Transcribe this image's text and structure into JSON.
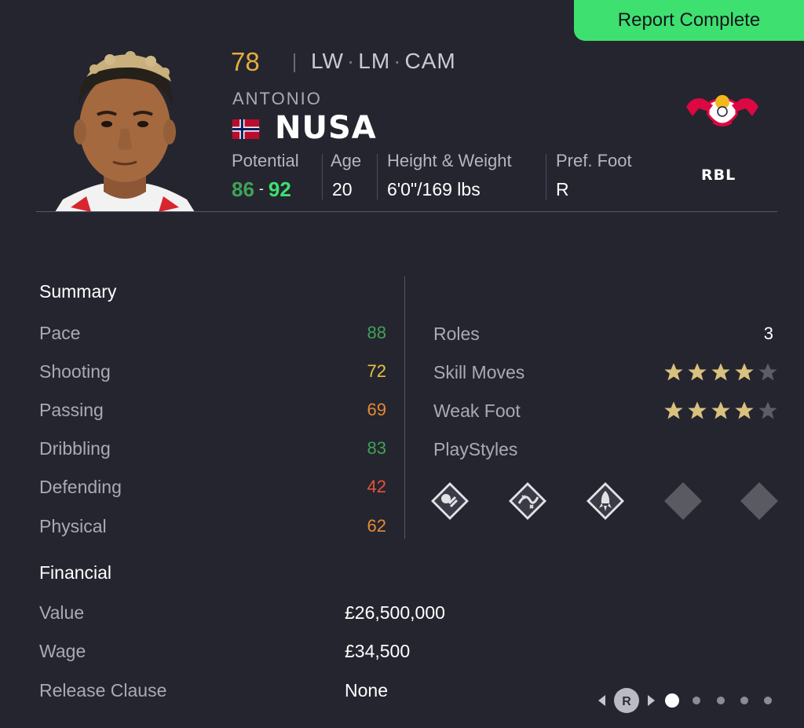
{
  "status_badge": "Report Complete",
  "player": {
    "overall": "78",
    "positions": [
      "LW",
      "LM",
      "CAM"
    ],
    "first_name": "ANTONIO",
    "last_name": "NUSA",
    "nationality_flag": "norway-flag-icon"
  },
  "attributes": {
    "potential": {
      "label": "Potential",
      "low": "86",
      "separator": "-",
      "high": "92"
    },
    "age": {
      "label": "Age",
      "value": "20"
    },
    "height_weight": {
      "label": "Height & Weight",
      "value": "6'0\"/169 lbs"
    },
    "pref_foot": {
      "label": "Pref. Foot",
      "value": "R"
    }
  },
  "club": {
    "abbr": "RBL",
    "crest": "rb-leipzig-crest-icon"
  },
  "summary": {
    "title": "Summary",
    "stats": [
      {
        "label": "Pace",
        "value": "88",
        "color": "#3fa255"
      },
      {
        "label": "Shooting",
        "value": "72",
        "color": "#e5c33f"
      },
      {
        "label": "Passing",
        "value": "69",
        "color": "#e58a33"
      },
      {
        "label": "Dribbling",
        "value": "83",
        "color": "#3fa255"
      },
      {
        "label": "Defending",
        "value": "42",
        "color": "#e5533a"
      },
      {
        "label": "Physical",
        "value": "62",
        "color": "#e58a33"
      }
    ]
  },
  "traits": {
    "roles": {
      "label": "Roles",
      "value": "3"
    },
    "skill_moves": {
      "label": "Skill Moves",
      "stars": 4,
      "max": 5
    },
    "weak_foot": {
      "label": "Weak Foot",
      "stars": 4,
      "max": 5
    },
    "playstyles": {
      "label": "PlayStyles",
      "items": [
        "first-touch-playstyle-icon",
        "technical-playstyle-icon",
        "rapid-playstyle-icon",
        "empty-playstyle-slot",
        "empty-playstyle-slot"
      ]
    }
  },
  "financial": {
    "title": "Financial",
    "rows": [
      {
        "label": "Value",
        "value": "£26,500,000"
      },
      {
        "label": "Wage",
        "value": "£34,500"
      },
      {
        "label": "Release Clause",
        "value": "None"
      }
    ]
  },
  "pager": {
    "button_label": "R",
    "pages": 5,
    "active_page": 1
  },
  "colors": {
    "accent": "#3ee070",
    "rating": "#e5ad3f",
    "star_filled": "#d9c17e",
    "star_empty": "#5c5d68"
  }
}
